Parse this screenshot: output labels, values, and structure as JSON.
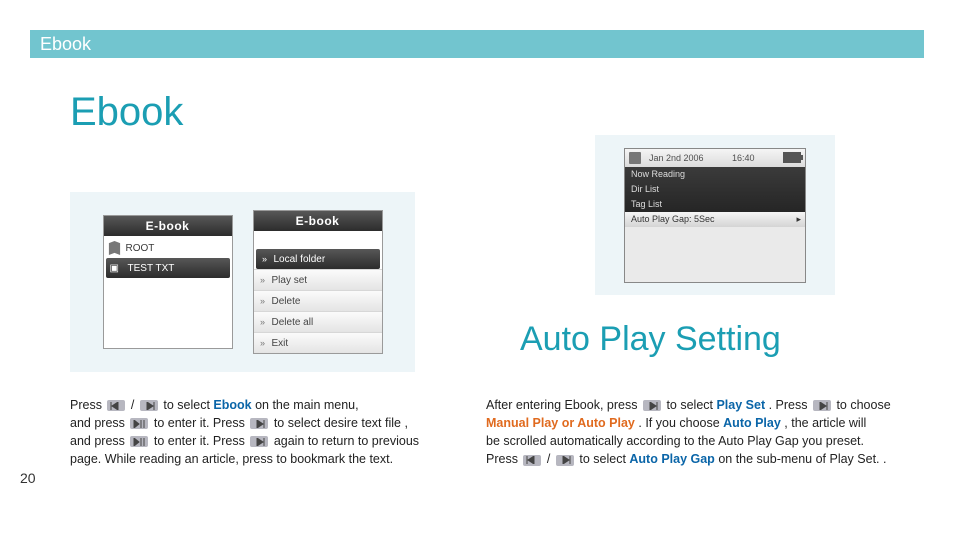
{
  "header": {
    "section_label": "Ebook"
  },
  "left": {
    "title": "Ebook",
    "panel1": {
      "title": "E-book",
      "rows": [
        {
          "label": "ROOT",
          "kind": "folder"
        },
        {
          "label": "TEST TXT",
          "kind": "file-selected"
        }
      ]
    },
    "panel2": {
      "title": "E-book",
      "rows": [
        {
          "label": "Local folder",
          "selected": true
        },
        {
          "label": "Play set"
        },
        {
          "label": "Delete"
        },
        {
          "label": "Delete all"
        },
        {
          "label": "Exit"
        }
      ]
    },
    "paragraph": {
      "line1a": "Press ",
      "line1b": " / ",
      "line1c": " to select ",
      "ebook": "Ebook",
      "line1d": " on the main menu,",
      "line2a": "and press ",
      "line2b": " to enter it. Press ",
      "line2c": " to select desire text file ,",
      "line3a": "and press ",
      "line3b": " to enter it. Press ",
      "line3c": " again to return to previous",
      "line4": "page. While reading an article, press to bookmark the text."
    }
  },
  "right": {
    "title": "Auto Play Setting",
    "device": {
      "date": "Jan 2nd 2006",
      "time": "16:40",
      "menu": [
        {
          "label": "Now Reading"
        },
        {
          "label": "Dir List"
        },
        {
          "label": "Tag List"
        },
        {
          "label": "Auto Play Gap: 5Sec",
          "selected": true
        }
      ]
    },
    "paragraph": {
      "t1": "After entering Ebook, press ",
      "t2": " to select ",
      "playset": "Play Set",
      "t3": ". Press ",
      "t4": " to choose",
      "mpap": "Manual Play or Auto Play",
      "t5": ". If you choose ",
      "autoplay": "Auto Play",
      "t6": ", the article will",
      "t7": "be scrolled automatically according to the Auto Play Gap you preset.",
      "t8a": "Press ",
      "t8b": " / ",
      "t8c": " to select ",
      "apg": "Auto Play Gap",
      "t8d": " on the sub-menu of Play Set. ."
    }
  },
  "page_number": "20",
  "icons": {
    "prev": "prev-track-icon",
    "next": "next-track-icon",
    "playpause": "play-pause-icon",
    "play": "play-next-icon"
  }
}
